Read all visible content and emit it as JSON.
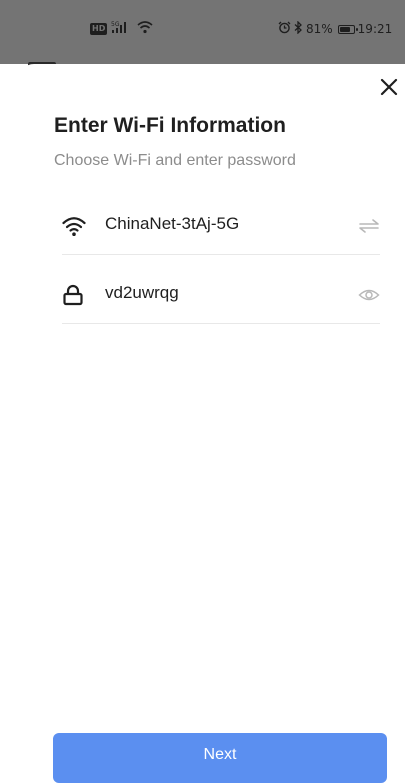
{
  "status_bar": {
    "hd_badge": "HD",
    "network": "5G",
    "battery_percent": "81%",
    "battery_level": 0.81,
    "time": "19:21",
    "alarm_icon": "alarm-icon",
    "bluetooth_icon": "bluetooth-icon"
  },
  "dialog": {
    "title": "Enter Wi-Fi Information",
    "subtitle": "Choose Wi-Fi and enter password",
    "close_icon": "close-icon"
  },
  "wifi_field": {
    "icon": "wifi-icon",
    "value": "ChinaNet-3tAj-5G",
    "action_icon": "switch-network-icon"
  },
  "password_field": {
    "icon": "lock-icon",
    "value": "vd2uwrqg",
    "action_icon": "eye-icon"
  },
  "next_button": {
    "label": "Next",
    "color": "#5b8ff0"
  }
}
